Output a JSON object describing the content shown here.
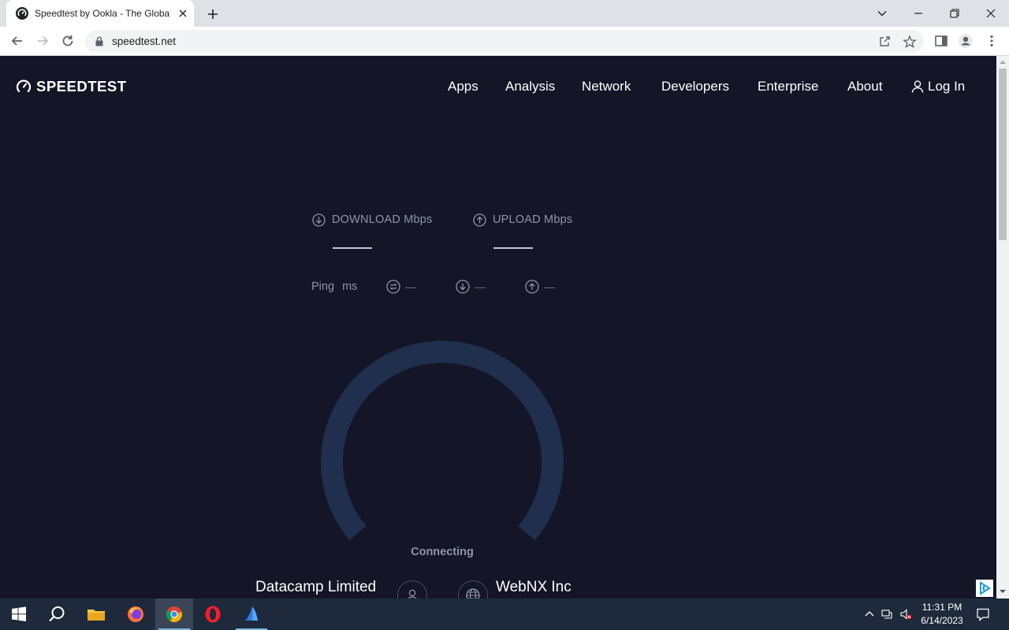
{
  "browser": {
    "tab_title": "Speedtest by Ookla - The Global Broadband Speed Test",
    "url": "speedtest.net"
  },
  "site": {
    "logo_text": "SPEEDTEST",
    "nav": [
      "Apps",
      "Analysis",
      "Network",
      "Developers",
      "Enterprise",
      "About"
    ],
    "login_label": "Log In"
  },
  "test": {
    "download_label": "DOWNLOAD Mbps",
    "upload_label": "UPLOAD Mbps",
    "ping_label": "Ping",
    "ping_unit": "ms",
    "jitter_value": "—",
    "ping_download_value": "—",
    "ping_upload_value": "—",
    "status": "Connecting",
    "isp_name": "Datacamp Limited",
    "server_name": "WebNX Inc"
  },
  "taskbar": {
    "time": "11:31 PM",
    "date": "6/14/2023"
  },
  "colors": {
    "page_bg": "#141526",
    "gauge_track": "#1f2f4d",
    "muted_text": "#9193a8"
  }
}
